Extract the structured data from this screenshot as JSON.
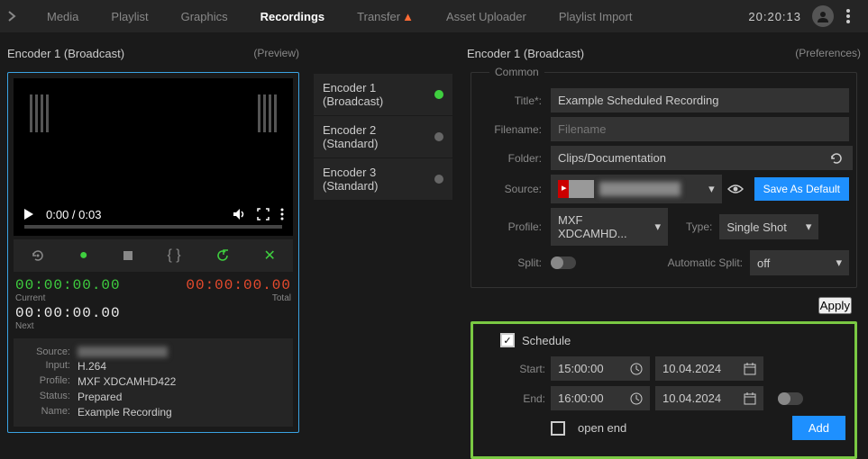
{
  "header": {
    "tabs": [
      "Media",
      "Playlist",
      "Graphics",
      "Recordings",
      "Transfer",
      "Asset Uploader",
      "Playlist Import"
    ],
    "active_tab": "Recordings",
    "transfer_warn": "▲",
    "clock": "20:20:13"
  },
  "preview": {
    "title": "Encoder 1 (Broadcast)",
    "subtitle": "(Preview)",
    "player_time": "0:00 / 0:03",
    "tc_current": "00:00:00.00",
    "tc_current_label": "Current",
    "tc_total": "00:00:00.00",
    "tc_total_label": "Total",
    "tc_next": "00:00:00.00",
    "tc_next_label": "Next",
    "info": {
      "source_label": "Source:",
      "input_label": "Input:",
      "input": "H.264",
      "profile_label": "Profile:",
      "profile": "MXF XDCAMHD422",
      "status_label": "Status:",
      "status": "Prepared",
      "name_label": "Name:",
      "name": "Example Recording"
    }
  },
  "encoders": [
    {
      "label": "Encoder 1 (Broadcast)",
      "active": true
    },
    {
      "label": "Encoder 2 (Standard)",
      "active": false
    },
    {
      "label": "Encoder 3 (Standard)",
      "active": false
    }
  ],
  "prefs": {
    "title": "Encoder 1 (Broadcast)",
    "subtitle": "(Preferences)",
    "common_legend": "Common",
    "labels": {
      "title": "Title*:",
      "filename": "Filename:",
      "folder": "Folder:",
      "source": "Source:",
      "profile": "Profile:",
      "type": "Type:",
      "split": "Split:",
      "auto_split": "Automatic Split:"
    },
    "values": {
      "title": "Example Scheduled Recording",
      "filename_placeholder": "Filename",
      "folder": "Clips/Documentation",
      "profile": "MXF XDCAMHD...",
      "type": "Single Shot",
      "auto_split": "off"
    },
    "buttons": {
      "save_default": "Save As Default",
      "apply": "Apply"
    }
  },
  "schedule": {
    "label": "Schedule",
    "start_label": "Start:",
    "start_time": "15:00:00",
    "start_date": "10.04.2024",
    "end_label": "End:",
    "end_time": "16:00:00",
    "end_date": "10.04.2024",
    "open_end_label": "open end",
    "add": "Add"
  }
}
